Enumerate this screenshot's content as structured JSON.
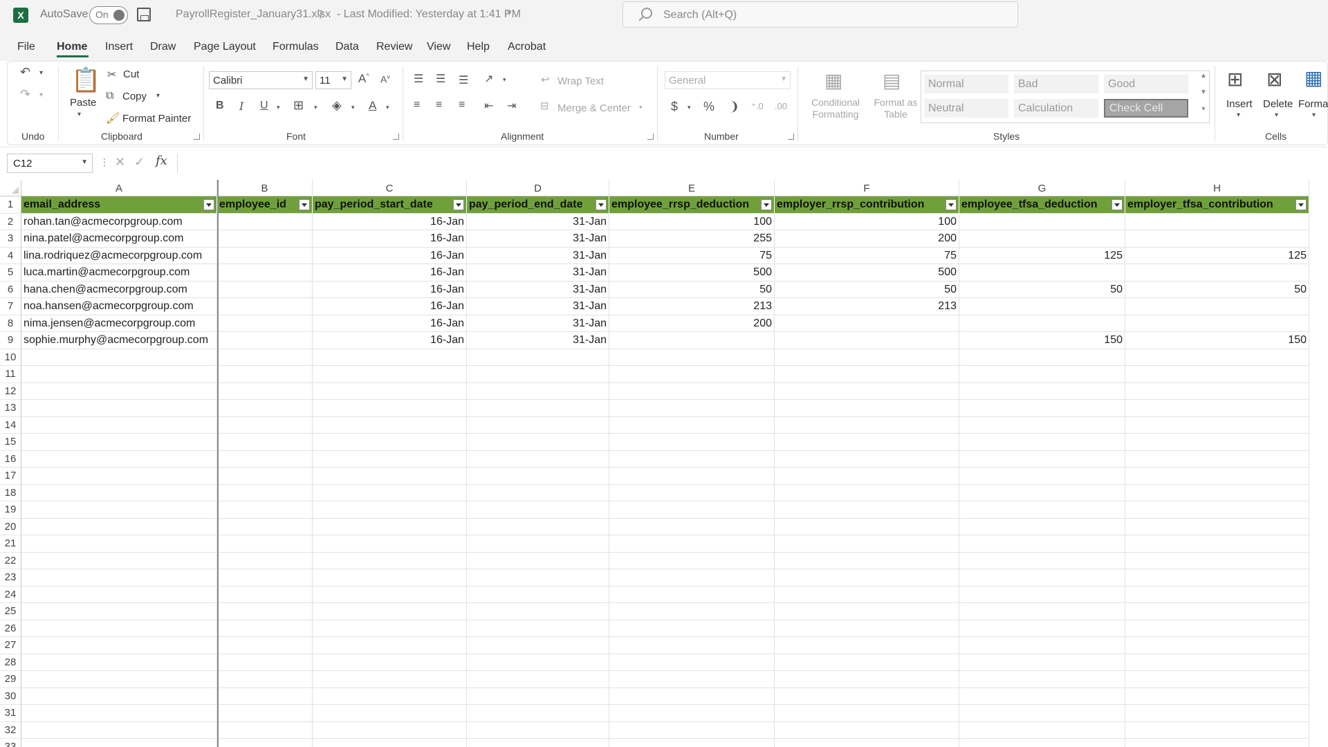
{
  "titlebar": {
    "app_logo": "X",
    "autosave_label": "AutoSave",
    "autosave_state": "On",
    "filename": "PayrollRegister_January31.xlsx",
    "last_modified": "- Last Modified: Yesterday at 1:41 PM",
    "search_placeholder": "Search (Alt+Q)"
  },
  "menu_tabs": [
    "File",
    "Home",
    "Insert",
    "Draw",
    "Page Layout",
    "Formulas",
    "Data",
    "Review",
    "View",
    "Help",
    "Acrobat"
  ],
  "active_tab": "Home",
  "ribbon": {
    "undo_group": "Undo",
    "clipboard": {
      "paste": "Paste",
      "cut": "Cut",
      "copy": "Copy",
      "format_painter": "Format Painter",
      "label": "Clipboard"
    },
    "font": {
      "name": "Calibri",
      "size": "11",
      "label": "Font"
    },
    "alignment": {
      "wrap_text": "Wrap Text",
      "merge_center": "Merge & Center",
      "label": "Alignment"
    },
    "number": {
      "format": "General",
      "label": "Number"
    },
    "styles": {
      "conditional_formatting": "Conditional Formatting",
      "format_as_table": "Format as Table",
      "items": [
        "Normal",
        "Bad",
        "Good",
        "Neutral",
        "Calculation",
        "Check Cell"
      ],
      "label": "Styles"
    },
    "cells": {
      "insert": "Insert",
      "delete": "Delete",
      "format": "Forma",
      "label": "Cells"
    }
  },
  "formula_bar": {
    "name_box": "C12",
    "fx": "fx",
    "value": ""
  },
  "sheet": {
    "columns": [
      "A",
      "B",
      "C",
      "D",
      "E",
      "F",
      "G",
      "H"
    ],
    "headers": [
      "email_address",
      "employee_id",
      "pay_period_start_date",
      "pay_period_end_date",
      "employee_rrsp_deduction",
      "employer_rrsp_contribution",
      "employee_tfsa_deduction",
      "employer_tfsa_contribution"
    ],
    "rows": [
      [
        "rohan.tan@acmecorpgroup.com",
        "",
        "16-Jan",
        "31-Jan",
        "100",
        "100",
        "",
        ""
      ],
      [
        "nina.patel@acmecorpgroup.com",
        "",
        "16-Jan",
        "31-Jan",
        "255",
        "200",
        "",
        ""
      ],
      [
        "lina.rodriquez@acmecorpgroup.com",
        "",
        "16-Jan",
        "31-Jan",
        "75",
        "75",
        "125",
        "125"
      ],
      [
        "luca.martin@acmecorpgroup.com",
        "",
        "16-Jan",
        "31-Jan",
        "500",
        "500",
        "",
        ""
      ],
      [
        "hana.chen@acmecorpgroup.com",
        "",
        "16-Jan",
        "31-Jan",
        "50",
        "50",
        "50",
        "50"
      ],
      [
        "noa.hansen@acmecorpgroup.com",
        "",
        "16-Jan",
        "31-Jan",
        "213",
        "213",
        "",
        ""
      ],
      [
        "nima.jensen@acmecorpgroup.com",
        "",
        "16-Jan",
        "31-Jan",
        "200",
        "",
        "",
        ""
      ],
      [
        "sophie.murphy@acmecorpgroup.com",
        "",
        "16-Jan",
        "31-Jan",
        "",
        "",
        "150",
        "150"
      ]
    ],
    "row_numbers": [
      "1",
      "2",
      "3",
      "4",
      "5",
      "6",
      "7",
      "8",
      "9",
      "10",
      "11",
      "12",
      "13",
      "14",
      "15",
      "16",
      "17",
      "18",
      "19",
      "20",
      "21",
      "22",
      "23",
      "24",
      "25",
      "26",
      "27",
      "28",
      "29",
      "30",
      "31",
      "32",
      "33"
    ],
    "header_fill": "#70a03b"
  }
}
